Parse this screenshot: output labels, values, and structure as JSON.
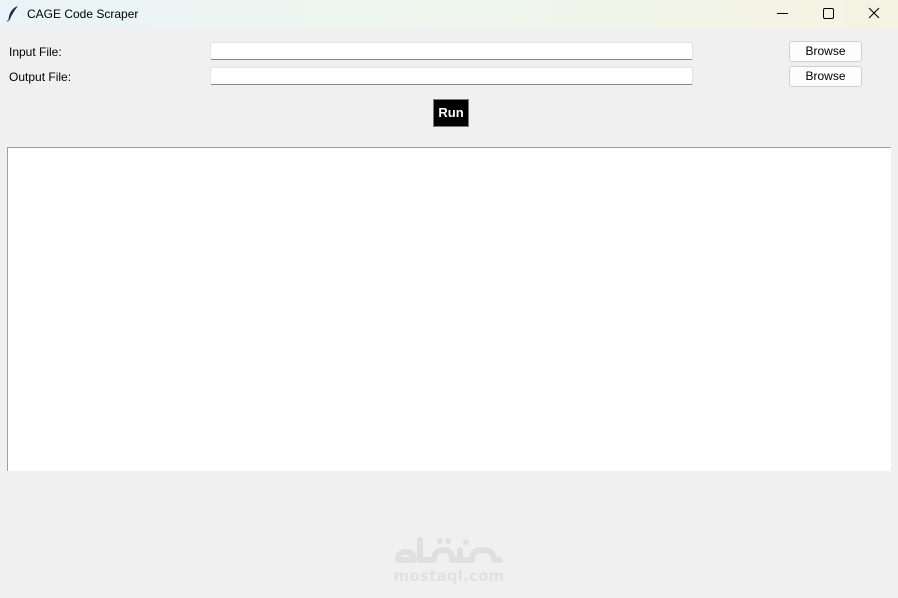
{
  "window": {
    "title": "CAGE Code Scraper",
    "icon": "feather-icon"
  },
  "form": {
    "input_label": "Input File:",
    "input_value": "",
    "output_label": "Output File:",
    "output_value": "",
    "browse_label": "Browse",
    "run_label": "Run"
  },
  "output": {
    "text": ""
  },
  "watermark": {
    "logo": "mostaql-logo",
    "text": "mostaql.com",
    "arabic": "مستقل"
  },
  "colors": {
    "background": "#f0f0f0",
    "run_button": "#000000",
    "run_text": "#ffffff"
  }
}
